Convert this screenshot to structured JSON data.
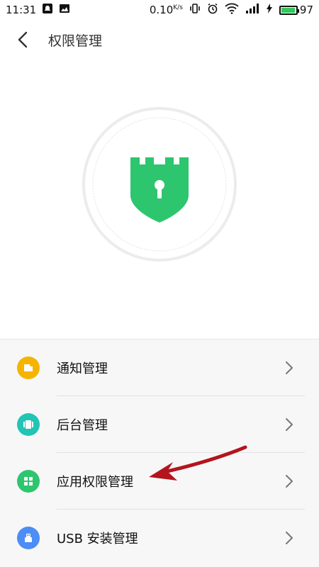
{
  "status_bar": {
    "time": "11:31",
    "net_speed_value": "0.10",
    "net_speed_unit": "K/s",
    "battery_level": "97",
    "battery_fill_fraction": 0.97,
    "icons": [
      "notification-icon",
      "image-icon",
      "vibrate-icon",
      "alarm-icon",
      "wifi-icon",
      "signal-icon",
      "charging-icon",
      "battery-icon"
    ]
  },
  "header": {
    "title": "权限管理",
    "back_icon": "back-arrow-icon"
  },
  "hero": {
    "icon": "security-shield-icon",
    "accent_color": "#2ec56f"
  },
  "list": {
    "items": [
      {
        "label": "通知管理",
        "icon": "notification-icon",
        "icon_color": "#f5b400"
      },
      {
        "label": "后台管理",
        "icon": "background-app-icon",
        "icon_color": "#22c4b4"
      },
      {
        "label": "应用权限管理",
        "icon": "app-grid-icon",
        "icon_color": "#2ec56f"
      },
      {
        "label": "USB 安装管理",
        "icon": "usb-icon",
        "icon_color": "#4c8df6"
      }
    ]
  },
  "annotation": {
    "type": "red-arrow-pointer",
    "color": "#b4141e"
  }
}
